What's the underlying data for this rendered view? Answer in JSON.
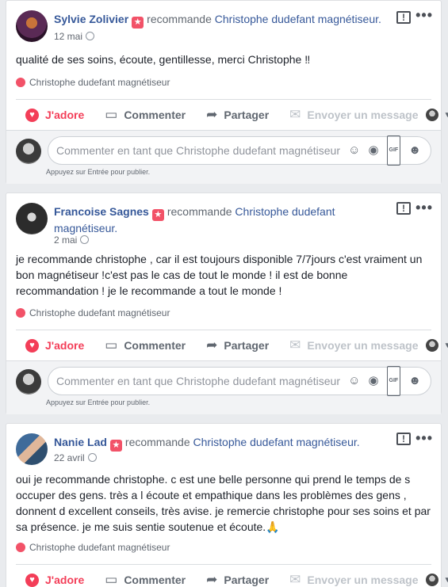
{
  "posts": [
    {
      "author": "Sylvie Zolivier",
      "rec_prefix": "recommande ",
      "page_name": "Christophe dudefant magnétiseur.",
      "date": "12 mai",
      "text": "qualité de ses soins, écoute, gentillesse, merci Christophe ‼",
      "tag": "Christophe dudefant magnétiseur"
    },
    {
      "author": "Francoise Sagnes",
      "rec_prefix": "recommande ",
      "page_name": "Christophe dudefant magnétiseur.",
      "date": "2 mai",
      "text": "je recommande christophe , car il est toujours disponible 7/7jours c'est vraiment un bon magnétiseur !c'est pas le cas de tout le monde ! il est de bonne recommandation ! je le recommande a tout le monde !",
      "tag": "Christophe dudefant magnétiseur"
    },
    {
      "author": "Nanie Lad",
      "rec_prefix": "recommande ",
      "page_name": "Christophe dudefant magnétiseur.",
      "date": "22 avril",
      "text": "oui je recommande christophe. c est une belle personne qui prend le temps de s occuper des gens. très a l écoute et empathique dans les problèmes des gens , donnent d excellent conseils, très avise. je remercie christophe pour ses soins et par sa présence. je me suis sentie soutenue et écoute.🙏",
      "tag": "Christophe dudefant magnétiseur"
    }
  ],
  "actions": {
    "adore": "J'adore",
    "comment": "Commenter",
    "share": "Partager",
    "message": "Envoyer un message"
  },
  "comment_box": {
    "placeholder": "Commenter en tant que Christophe dudefant magnétiseur",
    "hint": "Appuyez sur Entrée pour publier.",
    "gif_label": "GIF"
  },
  "icons": {
    "recommend": "recommend-icon",
    "globe": "globe-icon",
    "flag": "flag-icon",
    "more": "more-icon",
    "adore": "heart-icon",
    "comment": "comment-icon",
    "share": "share-icon",
    "message": "messenger-icon",
    "emoji": "emoji-icon",
    "camera": "camera-icon",
    "gif": "gif-icon",
    "sticker": "sticker-icon"
  },
  "colors": {
    "link": "#365899",
    "adore": "#f33e58",
    "recommend_badge": "#f25268"
  }
}
